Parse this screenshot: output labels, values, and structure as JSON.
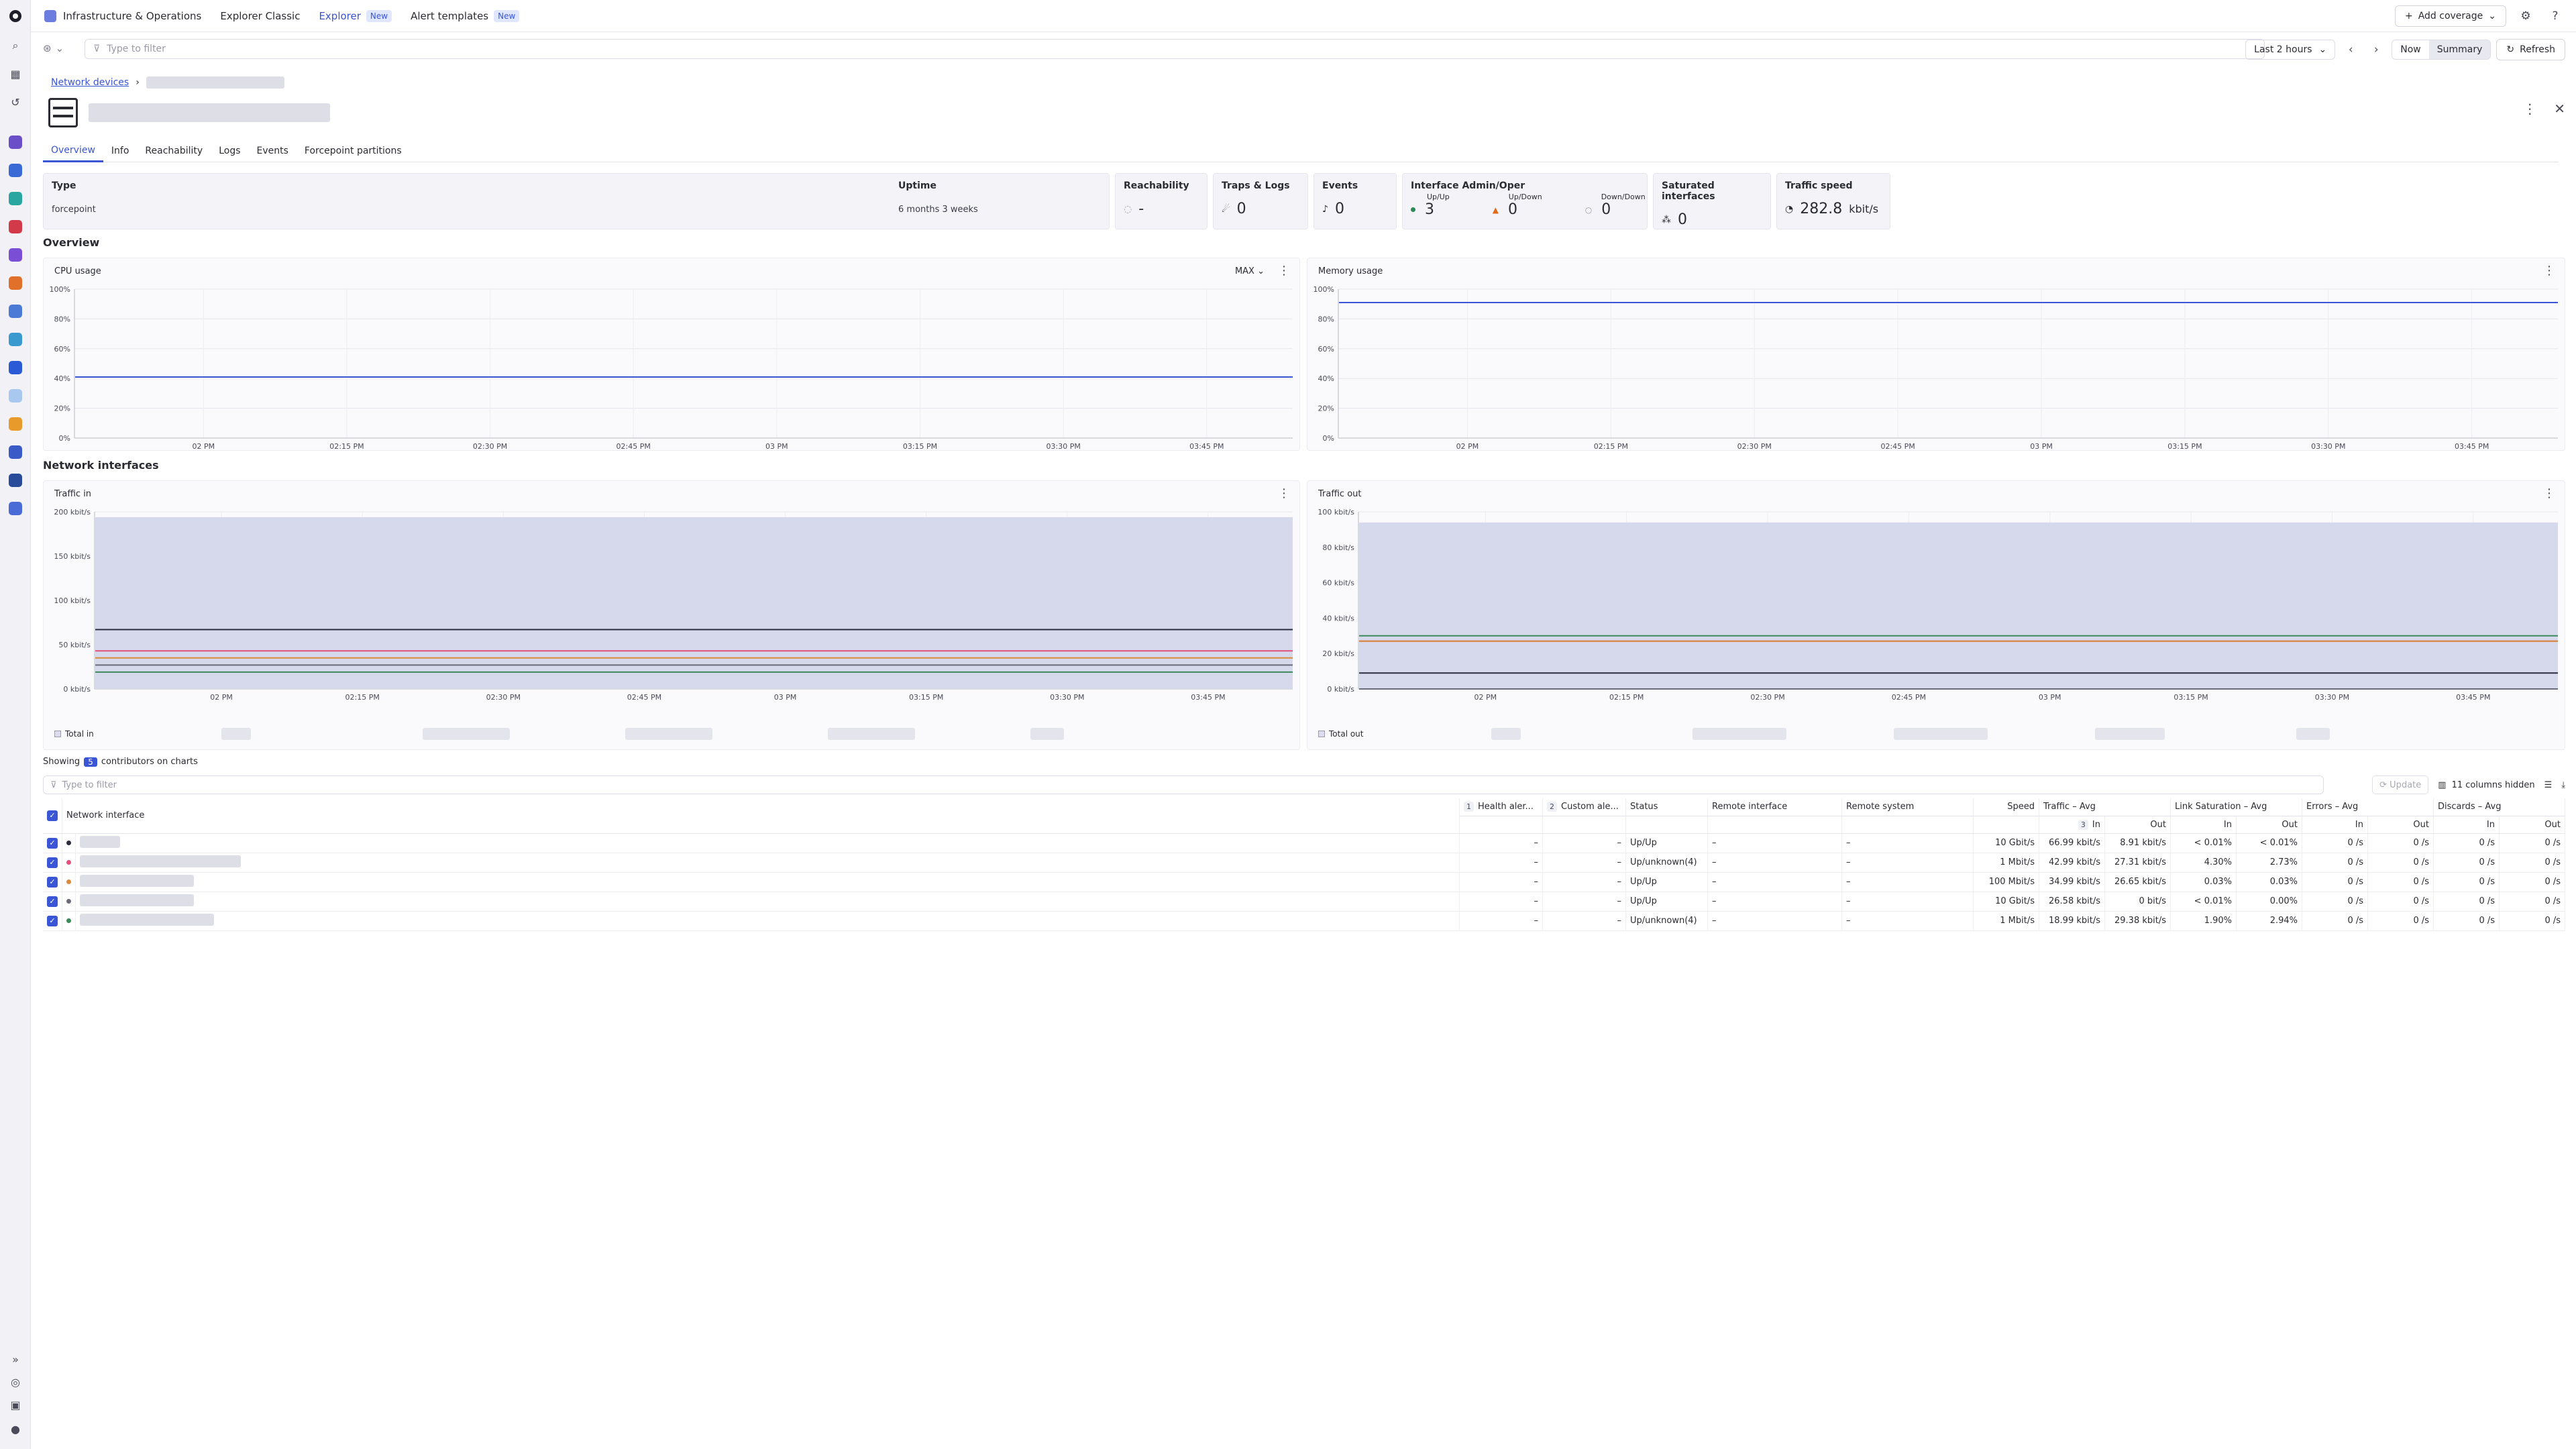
{
  "app": {
    "name": "Infrastructure & Operations"
  },
  "nav": [
    {
      "label": "Explorer Classic",
      "badge": ""
    },
    {
      "label": "Explorer",
      "badge": "New"
    },
    {
      "label": "Alert templates",
      "badge": "New"
    }
  ],
  "header": {
    "add_coverage": "Add coverage",
    "filter_placeholder": "Type to filter",
    "timeframe": "Last 2 hours",
    "now": "Now",
    "summary": "Summary",
    "refresh": "Refresh"
  },
  "breadcrumb": {
    "root": "Network devices"
  },
  "tabs": [
    "Overview",
    "Info",
    "Reachability",
    "Logs",
    "Events",
    "Forcepoint partitions"
  ],
  "kpis": {
    "type_label": "Type",
    "type_value": "forcepoint",
    "uptime_label": "Uptime",
    "uptime_value": "6 months 3 weeks",
    "reachability_label": "Reachability",
    "reachability_value": "-",
    "traps_label": "Traps & Logs",
    "traps_value": "0",
    "events_label": "Events",
    "events_value": "0",
    "iface_label": "Interface Admin/Oper",
    "upup_label": "Up/Up",
    "upup_value": "3",
    "updown_label": "Up/Down",
    "updown_value": "0",
    "downdown_label": "Down/Down",
    "downdown_value": "0",
    "saturated_label": "Saturated interfaces",
    "saturated_value": "0",
    "speed_label": "Traffic speed",
    "speed_value": "282.8",
    "speed_unit": "kbit/s"
  },
  "sections": {
    "overview": "Overview",
    "interfaces": "Network interfaces"
  },
  "charts": {
    "cpu": {
      "title": "CPU usage",
      "agg": "MAX"
    },
    "mem": {
      "title": "Memory usage"
    },
    "tin": {
      "title": "Traffic in",
      "legend_total": "Total in"
    },
    "tout": {
      "title": "Traffic out",
      "legend_total": "Total out"
    }
  },
  "chart_data": [
    {
      "type": "line",
      "id": "cpu",
      "x": [
        "02 PM",
        "02:15 PM",
        "02:30 PM",
        "02:45 PM",
        "03 PM",
        "03:15 PM",
        "03:30 PM",
        "03:45 PM"
      ],
      "y_ticks": [
        "0%",
        "20%",
        "40%",
        "60%",
        "80%",
        "100%"
      ],
      "ylim": [
        0,
        100
      ],
      "series": [
        {
          "values": [
            41,
            41,
            41,
            41,
            41,
            41,
            41,
            41
          ],
          "color": "#3a55d6"
        }
      ]
    },
    {
      "type": "line",
      "id": "mem",
      "x": [
        "02 PM",
        "02:15 PM",
        "02:30 PM",
        "02:45 PM",
        "03 PM",
        "03:15 PM",
        "03:30 PM",
        "03:45 PM"
      ],
      "y_ticks": [
        "0%",
        "20%",
        "40%",
        "60%",
        "80%",
        "100%"
      ],
      "ylim": [
        0,
        100
      ],
      "series": [
        {
          "values": [
            91,
            91,
            91,
            91,
            91,
            91,
            91,
            91
          ],
          "color": "#3a55d6"
        }
      ]
    },
    {
      "type": "area",
      "id": "tin",
      "x": [
        "02 PM",
        "02:15 PM",
        "02:30 PM",
        "02:45 PM",
        "03 PM",
        "03:15 PM",
        "03:30 PM",
        "03:45 PM"
      ],
      "y_ticks": [
        "0 kbit/s",
        "50 kbit/s",
        "100 kbit/s",
        "150 kbit/s",
        "200 kbit/s"
      ],
      "ylim": [
        0,
        200
      ],
      "total": 194,
      "series": [
        {
          "values": [
            67,
            67,
            67,
            67,
            67,
            67,
            67,
            67
          ],
          "color": "#2b2b40"
        },
        {
          "values": [
            43,
            43,
            43,
            43,
            43,
            43,
            43,
            43
          ],
          "color": "#e0507a"
        },
        {
          "values": [
            35,
            35,
            35,
            35,
            35,
            35,
            35,
            35
          ],
          "color": "#d98a3a"
        },
        {
          "values": [
            27,
            27,
            27,
            27,
            27,
            27,
            27,
            27
          ],
          "color": "#6a6a7a"
        },
        {
          "values": [
            19,
            19,
            19,
            19,
            19,
            19,
            19,
            19
          ],
          "color": "#3a8a5a"
        }
      ]
    },
    {
      "type": "area",
      "id": "tout",
      "x": [
        "02 PM",
        "02:15 PM",
        "02:30 PM",
        "02:45 PM",
        "03 PM",
        "03:15 PM",
        "03:30 PM",
        "03:45 PM"
      ],
      "y_ticks": [
        "0 kbit/s",
        "20 kbit/s",
        "40 kbit/s",
        "60 kbit/s",
        "80 kbit/s",
        "100 kbit/s"
      ],
      "ylim": [
        0,
        100
      ],
      "total": 94,
      "series": [
        {
          "values": [
            30,
            30,
            30,
            30,
            30,
            30,
            30,
            30
          ],
          "color": "#3a8a5a"
        },
        {
          "values": [
            27,
            27,
            27,
            27,
            27,
            27,
            27,
            27
          ],
          "color": "#e0507a"
        },
        {
          "values": [
            27,
            27,
            27,
            27,
            27,
            27,
            27,
            27
          ],
          "color": "#d98a3a"
        },
        {
          "values": [
            9,
            9,
            9,
            9,
            9,
            9,
            9,
            9
          ],
          "color": "#2b2b40"
        },
        {
          "values": [
            0,
            0,
            0,
            0,
            0,
            0,
            0,
            0
          ],
          "color": "#6a6a7a"
        }
      ]
    }
  ],
  "table": {
    "showing_prefix": "Showing",
    "showing_count": "5",
    "showing_suffix": "contributors on charts",
    "filter_placeholder": "Type to filter",
    "update": "Update",
    "hidden": "11 columns hidden",
    "headers": {
      "iface": "Network interface",
      "health_rank": "1",
      "health": "Health aler...",
      "custom_rank": "2",
      "custom": "Custom ale...",
      "status": "Status",
      "remote_if": "Remote interface",
      "remote_sys": "Remote system",
      "speed": "Speed",
      "traffic": "Traffic – Avg",
      "link": "Link Saturation – Avg",
      "errors": "Errors – Avg",
      "discards": "Discards – Avg",
      "in_rank": "3",
      "in": "In",
      "out": "Out"
    },
    "rows": [
      {
        "dot": "#2b2b40",
        "health": "–",
        "custom": "–",
        "status": "Up/Up",
        "remote_if": "–",
        "remote_sys": "–",
        "speed": "10 Gbit/s",
        "t_in": "66.99 kbit/s",
        "t_out": "8.91 kbit/s",
        "l_in": "< 0.01%",
        "l_out": "< 0.01%",
        "e_in": "0 /s",
        "e_out": "0 /s",
        "d_in": "0 /s",
        "d_out": "0 /s"
      },
      {
        "dot": "#e0507a",
        "health": "–",
        "custom": "–",
        "status": "Up/unknown(4)",
        "remote_if": "–",
        "remote_sys": "–",
        "speed": "1 Mbit/s",
        "t_in": "42.99 kbit/s",
        "t_out": "27.31 kbit/s",
        "l_in": "4.30%",
        "l_out": "2.73%",
        "e_in": "0 /s",
        "e_out": "0 /s",
        "d_in": "0 /s",
        "d_out": "0 /s"
      },
      {
        "dot": "#d98a3a",
        "health": "–",
        "custom": "–",
        "status": "Up/Up",
        "remote_if": "–",
        "remote_sys": "–",
        "speed": "100 Mbit/s",
        "t_in": "34.99 kbit/s",
        "t_out": "26.65 kbit/s",
        "l_in": "0.03%",
        "l_out": "0.03%",
        "e_in": "0 /s",
        "e_out": "0 /s",
        "d_in": "0 /s",
        "d_out": "0 /s"
      },
      {
        "dot": "#6a6a7a",
        "health": "–",
        "custom": "–",
        "status": "Up/Up",
        "remote_if": "–",
        "remote_sys": "–",
        "speed": "10 Gbit/s",
        "t_in": "26.58 kbit/s",
        "t_out": "0 bit/s",
        "l_in": "< 0.01%",
        "l_out": "0.00%",
        "e_in": "0 /s",
        "e_out": "0 /s",
        "d_in": "0 /s",
        "d_out": "0 /s"
      },
      {
        "dot": "#3a8a5a",
        "health": "–",
        "custom": "–",
        "status": "Up/unknown(4)",
        "remote_if": "–",
        "remote_sys": "–",
        "speed": "1 Mbit/s",
        "t_in": "18.99 kbit/s",
        "t_out": "29.38 kbit/s",
        "l_in": "1.90%",
        "l_out": "2.94%",
        "e_in": "0 /s",
        "e_out": "0 /s",
        "d_in": "0 /s",
        "d_out": "0 /s"
      }
    ]
  }
}
